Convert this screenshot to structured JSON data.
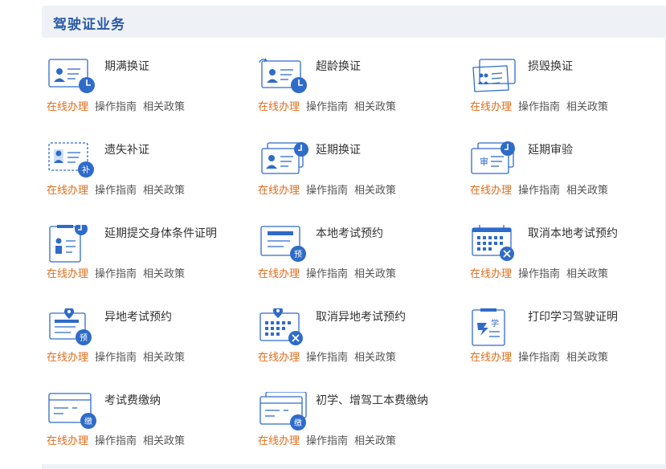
{
  "section": {
    "title": "驾驶证业务"
  },
  "link_labels": {
    "online": "在线办理",
    "guide": "操作指南",
    "policy": "相关政策"
  },
  "colors": {
    "accent": "#2f6bc9",
    "online_link": "#e06c1c",
    "header_bg": "#eef2f7"
  },
  "services": [
    {
      "name": "期满换证",
      "icon": "id-card-clock-icon"
    },
    {
      "name": "超龄换证",
      "icon": "id-card-clock-refresh-icon"
    },
    {
      "name": "损毁换证",
      "icon": "damaged-card-icon"
    },
    {
      "name": "遗失补证",
      "icon": "lost-card-icon",
      "badge": "补"
    },
    {
      "name": "延期换证",
      "icon": "stacked-card-clock-icon"
    },
    {
      "name": "延期审验",
      "icon": "review-card-clock-icon",
      "badge": "审"
    },
    {
      "name": "延期提交身体条件证明",
      "icon": "health-cert-clock-icon"
    },
    {
      "name": "本地考试预约",
      "icon": "local-exam-booking-icon",
      "badge": "预"
    },
    {
      "name": "取消本地考试预约",
      "icon": "calendar-cancel-icon"
    },
    {
      "name": "异地考试预约",
      "icon": "remote-exam-booking-icon",
      "badge": "预"
    },
    {
      "name": "取消异地考试预约",
      "icon": "calendar-location-cancel-icon"
    },
    {
      "name": "打印学习驾驶证明",
      "icon": "print-learner-cert-icon",
      "badge": "学"
    },
    {
      "name": "考试费缴纳",
      "icon": "exam-fee-icon",
      "badge": "缴"
    },
    {
      "name": "初学、增驾工本费缴纳",
      "icon": "cost-fee-icon",
      "badge": "缴"
    }
  ]
}
